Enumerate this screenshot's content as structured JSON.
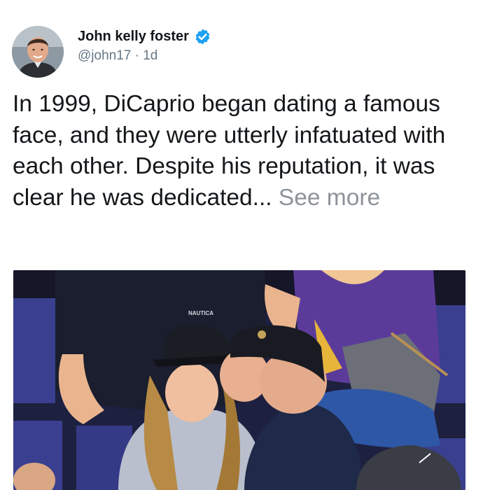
{
  "tweet": {
    "author": {
      "display_name": "John kelly foster",
      "handle": "@john17",
      "separator": "·",
      "timestamp": "1d",
      "verified_icon": "verified-badge-icon",
      "avatar": "avatar-photo"
    },
    "text": "In 1999, DiCaprio began dating a famous face, and they were utterly infatuated with each other. Despite his reputation, it was clear he was dedicated...",
    "see_more_label": "See more",
    "media": {
      "shirt_logo_text": "NAUTICA"
    }
  },
  "colors": {
    "verified": "#1da1f2",
    "text": "#14171a",
    "secondary": "#657786",
    "see_more": "#8c9399",
    "seat_blue": "#3a3f8f"
  }
}
